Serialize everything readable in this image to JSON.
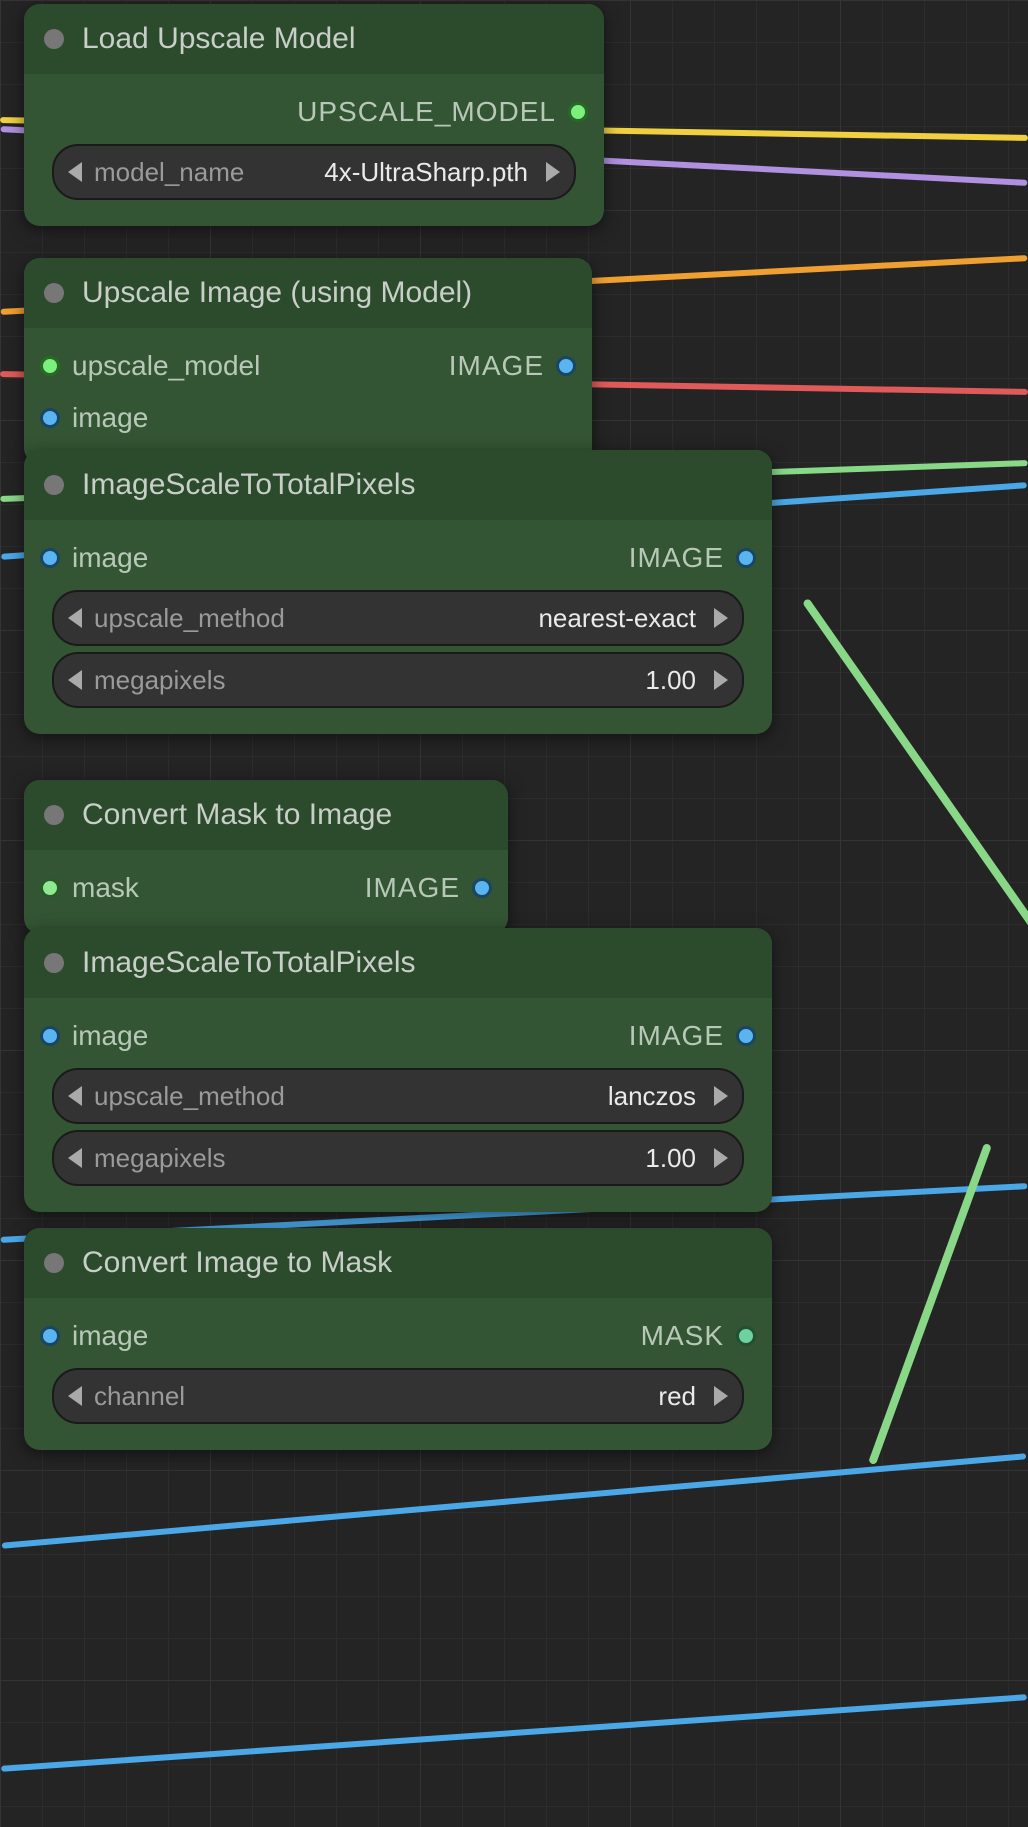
{
  "colors": {
    "node_bg": "#335533",
    "header_bg": "#2c4a2c",
    "wire_yellow": "#f0d040",
    "wire_purple": "#b090e0",
    "wire_orange": "#f0a030",
    "wire_red": "#e05a5a",
    "wire_blue": "#4aa8e8",
    "wire_green": "#88d888"
  },
  "nodes": {
    "load_upscale": {
      "title": "Load Upscale Model",
      "outputs": [
        {
          "label": "UPSCALE_MODEL",
          "color": "green"
        }
      ],
      "widgets": {
        "model_name": {
          "label": "model_name",
          "value": "4x-UltraSharp.pth"
        }
      }
    },
    "upscale_image": {
      "title": "Upscale Image (using Model)",
      "inputs": [
        {
          "label": "upscale_model",
          "color": "green"
        },
        {
          "label": "image",
          "color": "blue"
        }
      ],
      "outputs": [
        {
          "label": "IMAGE",
          "color": "blue"
        }
      ]
    },
    "scale_pixels_a": {
      "title": "ImageScaleToTotalPixels",
      "inputs": [
        {
          "label": "image",
          "color": "blue"
        }
      ],
      "outputs": [
        {
          "label": "IMAGE",
          "color": "blue"
        }
      ],
      "widgets": {
        "method": {
          "label": "upscale_method",
          "value": "nearest-exact"
        },
        "megapixels": {
          "label": "megapixels",
          "value": "1.00"
        }
      }
    },
    "mask_to_image": {
      "title": "Convert Mask to Image",
      "inputs": [
        {
          "label": "mask",
          "color": "lime"
        }
      ],
      "outputs": [
        {
          "label": "IMAGE",
          "color": "blue"
        }
      ]
    },
    "scale_pixels_b": {
      "title": "ImageScaleToTotalPixels",
      "inputs": [
        {
          "label": "image",
          "color": "blue"
        }
      ],
      "outputs": [
        {
          "label": "IMAGE",
          "color": "blue"
        }
      ],
      "widgets": {
        "method": {
          "label": "upscale_method",
          "value": "lanczos"
        },
        "megapixels": {
          "label": "megapixels",
          "value": "1.00"
        }
      }
    },
    "image_to_mask": {
      "title": "Convert Image to Mask",
      "inputs": [
        {
          "label": "image",
          "color": "blue"
        }
      ],
      "outputs": [
        {
          "label": "MASK",
          "color": "teal"
        }
      ],
      "widgets": {
        "channel": {
          "label": "channel",
          "value": "red"
        }
      }
    }
  }
}
